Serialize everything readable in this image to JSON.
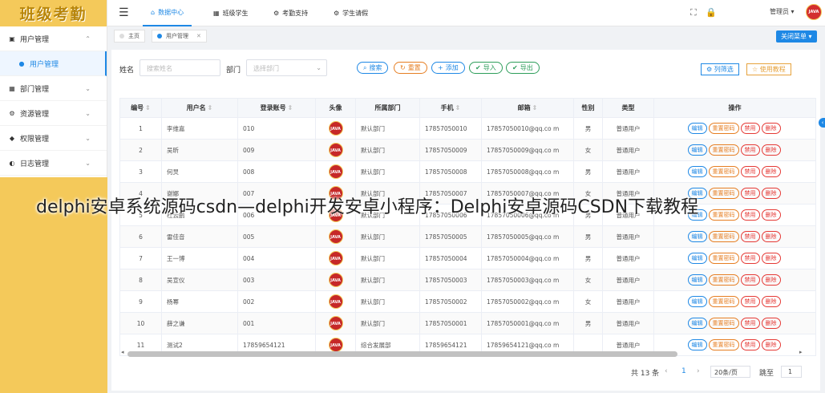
{
  "logo_text": "班级考勤",
  "sidebar": {
    "items": [
      {
        "label": "用户管理",
        "icon": "user-group-icon",
        "expanded": true
      },
      {
        "label": "用户管理",
        "icon": "user-icon",
        "sub": true
      },
      {
        "label": "部门管理",
        "icon": "grid-icon"
      },
      {
        "label": "资源管理",
        "icon": "gear-icon"
      },
      {
        "label": "权限管理",
        "icon": "lock-icon"
      },
      {
        "label": "日志管理",
        "icon": "log-icon"
      }
    ]
  },
  "topbar": {
    "tabs": [
      "数据中心",
      "班级学生",
      "考勤支持",
      "学生请假"
    ],
    "user": "管理员",
    "avatar_text": "JAVA"
  },
  "page_tabs": {
    "home": "主页",
    "current": "用户管理",
    "close_menu": "关闭菜单"
  },
  "search": {
    "name_label": "姓名",
    "name_placeholder": "搜索姓名",
    "dept_label": "部门",
    "dept_placeholder": "选择部门",
    "search_btn": "搜索",
    "reset_btn": "重置",
    "add_btn": "添加",
    "import_btn": "导入",
    "export_btn": "导出",
    "columns_btn": "列筛选",
    "help_btn": "使用教程"
  },
  "table": {
    "headers": [
      "编号",
      "用户名",
      "登录账号",
      "头像",
      "所属部门",
      "手机",
      "邮箱",
      "性别",
      "类型",
      "操作"
    ],
    "ops": [
      "编辑",
      "重置密码",
      "禁用",
      "删除"
    ],
    "rows": [
      [
        "1",
        "李维嘉",
        "010",
        "默认部门",
        "17857050010",
        "17857050010@qq.co m",
        "男",
        "普通用户"
      ],
      [
        "2",
        "吴昕",
        "009",
        "默认部门",
        "17857050009",
        "17857050009@qq.co m",
        "女",
        "普通用户"
      ],
      [
        "3",
        "何炅",
        "008",
        "默认部门",
        "17857050008",
        "17857050008@qq.co m",
        "男",
        "普通用户"
      ],
      [
        "4",
        "谢娜",
        "007",
        "默认部门",
        "17857050007",
        "17857050007@qq.co m",
        "女",
        "普通用户"
      ],
      [
        "5",
        "杜云鹏",
        "006",
        "默认部门",
        "17857050006",
        "17857050006@qq.co m",
        "男",
        "普通用户"
      ],
      [
        "6",
        "雷佳音",
        "005",
        "默认部门",
        "17857050005",
        "17857050005@qq.co m",
        "男",
        "普通用户"
      ],
      [
        "7",
        "王一博",
        "004",
        "默认部门",
        "17857050004",
        "17857050004@qq.co m",
        "男",
        "普通用户"
      ],
      [
        "8",
        "吴宣仪",
        "003",
        "默认部门",
        "17857050003",
        "17857050003@qq.co m",
        "女",
        "普通用户"
      ],
      [
        "9",
        "杨幂",
        "002",
        "默认部门",
        "17857050002",
        "17857050002@qq.co m",
        "女",
        "普通用户"
      ],
      [
        "10",
        "薛之谦",
        "001",
        "默认部门",
        "17857050001",
        "17857050001@qq.co m",
        "男",
        "普通用户"
      ],
      [
        "11",
        "测试2",
        "17859654121",
        "综合发展部",
        "17859654121",
        "17859654121@qq.co m",
        "",
        "普通用户"
      ]
    ]
  },
  "pagination": {
    "total": "共 13 条",
    "page": "1",
    "per_page": "20条/页",
    "goto": "跳至",
    "goto_value": "1"
  },
  "watermark": "delphi安卓系统源码csdn—delphi开发安卓小程序：Delphi安卓源码CSDN下载教程"
}
